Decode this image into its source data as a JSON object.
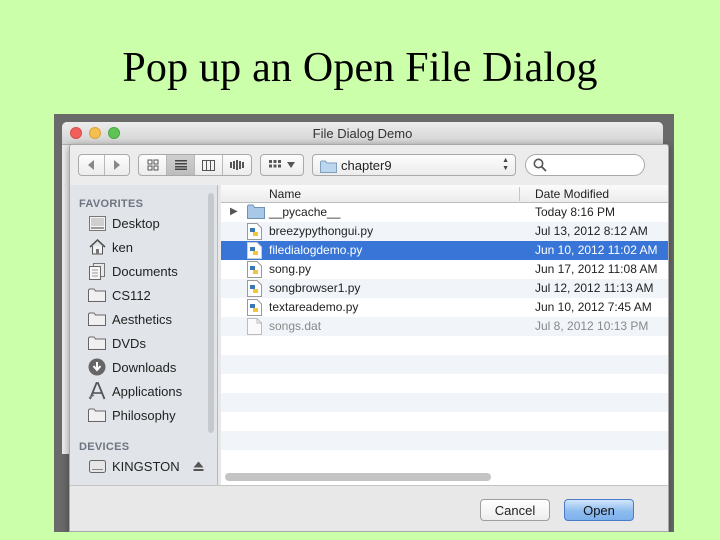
{
  "slide": {
    "title": "Pop up an Open File Dialog"
  },
  "window": {
    "title": "File Dialog Demo"
  },
  "toolbar": {
    "back_icon": "chevron-left-icon",
    "forward_icon": "chevron-right-icon",
    "view_modes": [
      "icon-view",
      "list-view",
      "column-view",
      "cover-flow-view"
    ],
    "active_view": "list-view",
    "arrange_icon": "arrange-grid-icon",
    "location": "chapter9",
    "search_placeholder": ""
  },
  "sidebar": {
    "favorites_header": "FAVORITES",
    "favorites": [
      {
        "label": "Desktop",
        "icon": "desktop-icon"
      },
      {
        "label": "ken",
        "icon": "home-icon"
      },
      {
        "label": "Documents",
        "icon": "documents-icon"
      },
      {
        "label": "CS112",
        "icon": "folder-icon"
      },
      {
        "label": "Aesthetics",
        "icon": "folder-icon"
      },
      {
        "label": "DVDs",
        "icon": "folder-icon"
      },
      {
        "label": "Downloads",
        "icon": "downloads-icon"
      },
      {
        "label": "Applications",
        "icon": "applications-icon"
      },
      {
        "label": "Philosophy",
        "icon": "folder-icon"
      }
    ],
    "devices_header": "DEVICES",
    "devices": [
      {
        "label": "KINGSTON",
        "icon": "drive-icon",
        "eject_icon": "eject-icon"
      }
    ]
  },
  "list": {
    "columns": {
      "name": "Name",
      "date": "Date Modified"
    },
    "rows": [
      {
        "name": "__pycache__",
        "date": "Today 8:16 PM",
        "kind": "folder",
        "expandable": true
      },
      {
        "name": "breezypythongui.py",
        "date": "Jul 13, 2012 8:12 AM",
        "kind": "python"
      },
      {
        "name": "filedialogdemo.py",
        "date": "Jun 10, 2012 11:02 AM",
        "kind": "python",
        "selected": true
      },
      {
        "name": "song.py",
        "date": "Jun 17, 2012 11:08 AM",
        "kind": "python"
      },
      {
        "name": "songbrowser1.py",
        "date": "Jul 12, 2012 11:13 AM",
        "kind": "python"
      },
      {
        "name": "textareademo.py",
        "date": "Jun 10, 2012 7:45 AM",
        "kind": "python"
      },
      {
        "name": "songs.dat",
        "date": "Jul 8, 2012 10:13 PM",
        "kind": "document",
        "disabled": true
      }
    ]
  },
  "buttons": {
    "cancel": "Cancel",
    "open": "Open"
  },
  "colors": {
    "slide_bg": "#ccffaa",
    "selection": "#3875d7",
    "open_button": "#8fbdf0"
  }
}
